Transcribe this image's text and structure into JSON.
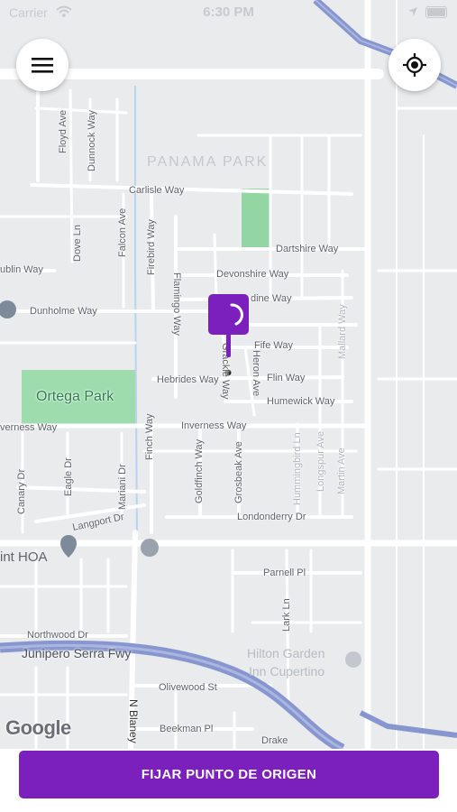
{
  "status_bar": {
    "carrier": "Carrier",
    "time": "6:30 PM"
  },
  "map": {
    "area_label": "PANAMA PARK",
    "park_label": "Ortega Park",
    "poi_labels": {
      "hoa": "int HOA",
      "hotel_line1": "Hilton Garden",
      "hotel_line2": "Inn Cupertino"
    },
    "highway_label": "Junipero Serra Fwy",
    "streets": {
      "carlisle": "Carlisle Way",
      "dartshire": "Dartshire Way",
      "devonshire": "Devonshire Way",
      "dunholme": "Dunholme Way",
      "hebrides": "Hebrides Way",
      "fife": "Fife Way",
      "flin": "Flin Way",
      "humewick": "Humewick Way",
      "inverness_left": "verness Way",
      "inverness": "Inverness Way",
      "langport": "Langport Dr",
      "londonderry": "Londonderry Dr",
      "parnell": "Parnell Pl",
      "northwood": "Northwood Dr",
      "olivewood": "Olivewood St",
      "beekman": "Beekman Pl",
      "dublin": "ublin Way",
      "dine": "dine Way",
      "floyd": "Floyd Ave",
      "dunnock": "Dunnock Way",
      "falcon": "Falcon Ave",
      "dove": "Dove Ln",
      "firebird": "Firebird Way",
      "flamingo": "Flamingo Way",
      "finch": "Finch Way",
      "canary": "Canary Dr",
      "eagle": "Eagle Dr",
      "mariani": "Mariani Dr",
      "goldfinch": "Goldfinch Way",
      "grosbeak": "Grosbeak Ave",
      "hummingbird": "Hummingbird Ln",
      "longspur": "Longspur Ave",
      "martin": "Martin Ave",
      "mallard": "Mallard Way",
      "heron": "Heron Ave",
      "grackle": "Grackle Way",
      "lark": "Lark Ln",
      "blaney": "N Blaney",
      "drake": "Drake"
    },
    "attribution": "Google"
  },
  "controls": {
    "menu_icon": "hamburger-menu-icon",
    "locate_icon": "my-location-icon"
  },
  "action": {
    "set_origin_label": "FIJAR PUNTO DE ORIGEN"
  },
  "colors": {
    "accent": "#7b1fbd",
    "map_bg": "#eaebed",
    "road": "#ffffff",
    "park": "#93d6a4",
    "highway": "#8796cf"
  }
}
